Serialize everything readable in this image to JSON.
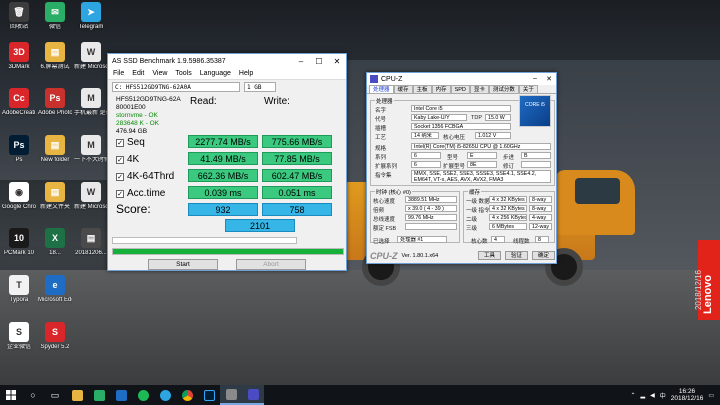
{
  "desktop": {
    "icons": [
      {
        "label": "回收站",
        "glyph": "🗑",
        "color": "#3c3c3c"
      },
      {
        "label": "微信",
        "glyph": "✉",
        "color": "#2aae67"
      },
      {
        "label": "Telegram",
        "glyph": "➤",
        "color": "#2ca5e0"
      },
      {
        "label": "3DMark",
        "glyph": "3D",
        "color": "#d9262b"
      },
      {
        "label": "6.屏幕测试",
        "glyph": "▤",
        "color": "#e8b543"
      },
      {
        "label": "新建 Microsoft...",
        "glyph": "W",
        "color": "#e9e9e9"
      },
      {
        "label": "AdobeCreati...",
        "glyph": "Cc",
        "color": "#d9262b"
      },
      {
        "label": "Adobe Photosh...",
        "glyph": "Ps",
        "color": "#c8312c"
      },
      {
        "label": "手机最新 是否",
        "glyph": "M",
        "color": "#e9e9e9"
      },
      {
        "label": "Ps",
        "glyph": "Ps",
        "color": "#001d34"
      },
      {
        "label": "New folder",
        "glyph": "▤",
        "color": "#e8b543"
      },
      {
        "label": "一下不大时修",
        "glyph": "M",
        "color": "#e9e9e9"
      },
      {
        "label": "Google Chrome",
        "glyph": "◉",
        "color": "#ffffff"
      },
      {
        "label": "新建文件夹",
        "glyph": "▤",
        "color": "#e8b543"
      },
      {
        "label": "新建 Microsoft 2018...",
        "glyph": "W",
        "color": "#e9e9e9"
      },
      {
        "label": "PCMark 10",
        "glyph": "10",
        "color": "#1a1a1a"
      },
      {
        "label": "18...",
        "glyph": "X",
        "color": "#1e7145"
      },
      {
        "label": "20181206...",
        "glyph": "▤",
        "color": "#4a4a4a"
      },
      {
        "label": "Typora",
        "glyph": "T",
        "color": "#f2f2f2"
      },
      {
        "label": "Microsoft Edge",
        "glyph": "e",
        "color": "#1f6cc4"
      },
      {
        "label": "企业微信",
        "glyph": "S",
        "color": "#ffffff"
      },
      {
        "label": "Spyder 5.2",
        "glyph": "S",
        "color": "#d9262b"
      }
    ]
  },
  "asssd": {
    "title": "AS SSD Benchmark 1.9.5986.35387",
    "menu": [
      "File",
      "Edit",
      "View",
      "Tools",
      "Language",
      "Help"
    ],
    "drive_select": "C: HFS512GD9TNG-62A0A",
    "size_select": "1 GB",
    "info": {
      "model": "HFS512GD9TNG-62A",
      "fw": "80001E00",
      "driver": "stornvme - OK",
      "align": "283648 K - OK",
      "capacity": "476.94 GB"
    },
    "read_head": "Read:",
    "write_head": "Write:",
    "rows": [
      {
        "label": "Seq",
        "read": "2277.74 MB/s",
        "write": "775.66 MB/s"
      },
      {
        "label": "4K",
        "read": "41.49 MB/s",
        "write": "77.85 MB/s"
      },
      {
        "label": "4K-64Thrd",
        "read": "662.36 MB/s",
        "write": "602.47 MB/s"
      },
      {
        "label": "Acc.time",
        "read": "0.039 ms",
        "write": "0.051 ms"
      }
    ],
    "score_label": "Score:",
    "score_read": "932",
    "score_write": "758",
    "score_total": "2101",
    "progress": 1.0,
    "start_label": "Start",
    "abort_label": "Abort"
  },
  "cpuz": {
    "title": "CPU-Z",
    "tabs": [
      "处理器",
      "缓存",
      "主板",
      "内存",
      "SPD",
      "显卡",
      "测试分数",
      "关于"
    ],
    "processor_group": "处理器",
    "name_label": "名字",
    "name": "Intel Core i5",
    "code_label": "代号",
    "code": "Kaby Lake-U/Y",
    "tdp_label": "TDP",
    "tdp": "15.0 W",
    "socket_label": "插槽",
    "socket": "Socket 1356 FCBGA",
    "tech_label": "工艺",
    "tech": "14 纳米",
    "vcore_label": "核心电压",
    "vcore": "1.012 V",
    "spec_label": "规格",
    "spec": "Intel(R) Core(TM) i5-8265U CPU @ 1.60GHz",
    "family_label": "系列",
    "family": "6",
    "model_label": "型号",
    "model": "E",
    "stepping_label": "步进",
    "stepping": "B",
    "extfam_label": "扩展系列",
    "extfam": "6",
    "extmodel_label": "扩展型号",
    "extmodel": "8E",
    "rev_label": "修订",
    "rev": "",
    "instr_label": "指令集",
    "instr": "MMX, SSE, SSE2, SSE3, SSSE3, SSE4.1, SSE4.2, EM64T, VT-x, AES, AVX, AVX2, FMA3",
    "intel_logo": "CORE i5",
    "clock_group": "时钟 (核心 #0)",
    "core_speed_label": "核心速度",
    "core_speed": "3889.51 MHz",
    "mult_label": "倍频",
    "mult": "x 39.0 ( 4 - 39 )",
    "bus_label": "总线速度",
    "bus": "99.76 MHz",
    "fsb_label": "额定 FSB",
    "fsb": "",
    "cache_group": "缓存",
    "l1d_label": "一级 数据",
    "l1d": "4 x 32 KBytes",
    "l1d_way": "8-way",
    "l1i_label": "一级 指令",
    "l1i": "4 x 32 KBytes",
    "l1i_way": "8-way",
    "l2_label": "二级",
    "l2": "4 x 256 KBytes",
    "l2_way": "4-way",
    "l3_label": "三级",
    "l3": "6 MBytes",
    "l3_way": "12-way",
    "sel_label": "已选择",
    "sel": "处理器 #1",
    "cores_label": "核心数",
    "cores": "4",
    "threads_label": "线程数",
    "threads": "8",
    "ver": "Ver. 1.80.1.x64",
    "tools_btn": "工具",
    "validate_btn": "验证",
    "ok_btn": "确定"
  },
  "wall": {
    "brand": "Lenovo",
    "date_stamp": "2018/12/16"
  },
  "taskbar": {
    "time": "16:26",
    "date": "2018/12/16"
  }
}
